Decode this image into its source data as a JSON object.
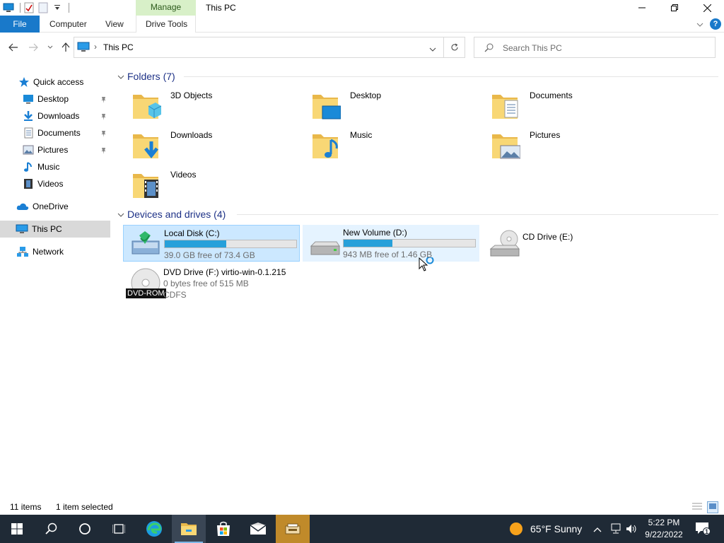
{
  "window": {
    "title": "This PC",
    "context_tab": "Manage"
  },
  "ribbon": {
    "tabs": [
      "File",
      "Computer",
      "View",
      "Drive Tools"
    ]
  },
  "address": {
    "path": "This PC",
    "search_placeholder": "Search This PC"
  },
  "nav": {
    "quick_access": "Quick access",
    "quick_items": [
      {
        "label": "Desktop",
        "icon": "desktop-icon"
      },
      {
        "label": "Downloads",
        "icon": "downloads-icon"
      },
      {
        "label": "Documents",
        "icon": "documents-icon"
      },
      {
        "label": "Pictures",
        "icon": "pictures-icon"
      },
      {
        "label": "Music",
        "icon": "music-icon"
      },
      {
        "label": "Videos",
        "icon": "videos-icon"
      }
    ],
    "onedrive": "OneDrive",
    "this_pc": "This PC",
    "network": "Network"
  },
  "folders": {
    "header": "Folders (7)",
    "items": [
      "3D Objects",
      "Desktop",
      "Documents",
      "Downloads",
      "Music",
      "Pictures",
      "Videos"
    ]
  },
  "drives": {
    "header": "Devices and drives (4)",
    "local_c": {
      "name": "Local Disk (C:)",
      "free": "39.0 GB free of 73.4 GB",
      "used_fraction": 0.47
    },
    "new_d": {
      "name": "New Volume (D:)",
      "free": "943 MB free of 1.46 GB",
      "used_fraction": 0.37
    },
    "cd_e": {
      "name": "CD Drive (E:)"
    },
    "dvd_f": {
      "name": "DVD Drive (F:) virtio-win-0.1.215",
      "free": "0 bytes free of 515 MB",
      "fs": "CDFS",
      "badge": "DVD-ROM"
    }
  },
  "status": {
    "items": "11 items",
    "selected": "1 item selected"
  },
  "taskbar": {
    "weather": "65°F  Sunny",
    "time": "5:22 PM",
    "date": "9/22/2022",
    "notifications": "1"
  },
  "colors": {
    "accent": "#1979ca",
    "manage": "#d8f0c8",
    "header_blue": "#1e3287",
    "bar_fill": "#26a0da",
    "taskbar": "#1f2a36"
  }
}
